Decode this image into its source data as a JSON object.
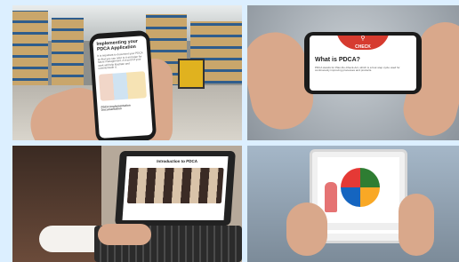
{
  "tiles": {
    "phone_warehouse": {
      "title": "Implementing your PDCA Application",
      "body": "It is important to document your PDCA so that you can refer to it and plan for future management. A record of your work will help illustrate and communicate it.",
      "footer": "PDCA Implementation Documentation"
    },
    "landscape_phone": {
      "badge_label": "CHECK",
      "badge_icon": "magnifier-icon",
      "title": "What is PDCA?",
      "body": "PDCA stands for Plan-Do-Check-Act, which is a four-step cycle used for continuously improving processes and products."
    },
    "laptop": {
      "slide_title": "Introduction to PDCA"
    },
    "tablet": {
      "chart_colors": [
        "#2e7d32",
        "#f9a825",
        "#1565c0",
        "#e53935",
        "#fb8c00"
      ]
    }
  }
}
